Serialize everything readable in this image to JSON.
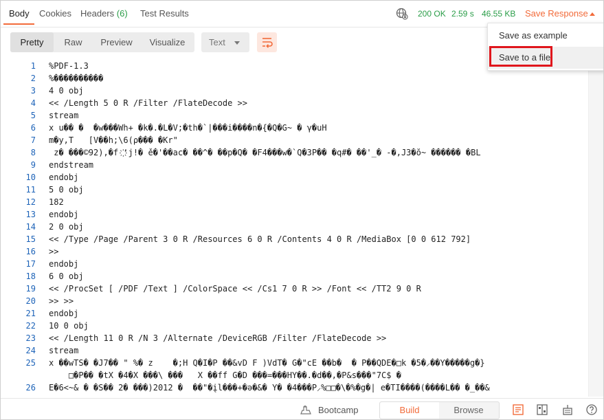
{
  "tabs": {
    "body": "Body",
    "cookies": "Cookies",
    "headers": "Headers",
    "headers_count": "(6)",
    "test_results": "Test Results"
  },
  "status": {
    "code": "200 OK",
    "time": "2.59 s",
    "size": "46.55 KB"
  },
  "save_response": {
    "label": "Save Response",
    "menu": {
      "save_as_example": "Save as example",
      "save_to_file": "Save to a file"
    }
  },
  "toolbar": {
    "pretty": "Pretty",
    "raw": "Raw",
    "preview": "Preview",
    "visualize": "Visualize",
    "format": "Text"
  },
  "code": {
    "lines": [
      {
        "n": "1",
        "t": "%PDF-1.3"
      },
      {
        "n": "2",
        "t": "%����������"
      },
      {
        "n": "3",
        "t": "4 0 obj"
      },
      {
        "n": "4",
        "t": "<< /Length 5 0 R /Filter /FlateDecode >>"
      },
      {
        "n": "5",
        "t": "stream"
      },
      {
        "n": "6",
        "t": "x u�� �  �w���Wh+ �k�.�L�V;�th�`|���i����n�{�Q�G~ � γ�uH"
      },
      {
        "n": "7",
        "t": "m�y,T   [V��h;\\6(ρ��� �Kr\""
      },
      {
        "n": "8",
        "t": " z� ���©92),�f ҉'j!� ě�'��ac� ��^� ��p�Q� �F4���w�`Q�3P�� �q#� ��'_� -�,J3�ŏ~ ������ �BL"
      },
      {
        "n": "9",
        "t": "endstream"
      },
      {
        "n": "10",
        "t": "endobj"
      },
      {
        "n": "11",
        "t": "5 0 obj"
      },
      {
        "n": "12",
        "t": "182"
      },
      {
        "n": "13",
        "t": "endobj"
      },
      {
        "n": "14",
        "t": "2 0 obj"
      },
      {
        "n": "15",
        "t": "<< /Type /Page /Parent 3 0 R /Resources 6 0 R /Contents 4 0 R /MediaBox [0 0 612 792]"
      },
      {
        "n": "16",
        "t": ">>"
      },
      {
        "n": "17",
        "t": "endobj"
      },
      {
        "n": "18",
        "t": "6 0 obj"
      },
      {
        "n": "19",
        "t": "<< /ProcSet [ /PDF /Text ] /ColorSpace << /Cs1 7 0 R >> /Font << /TT2 9 0 R"
      },
      {
        "n": "20",
        "t": ">> >>"
      },
      {
        "n": "21",
        "t": "endobj"
      },
      {
        "n": "22",
        "t": "10 0 obj"
      },
      {
        "n": "23",
        "t": "<< /Length 11 0 R /N 3 /Alternate /DeviceRGB /Filter /FlateDecode >>"
      },
      {
        "n": "24",
        "t": "stream"
      },
      {
        "n": "25",
        "t": "x ��wTS� �J7�� \" %� z    �;H Q�I�P ��&vD F )VdT� G�\"cE ��b�  � P��QDE�□k �5�⸝��Y�����g�}\n    □�P�� �tX �4�X ���\\ ���   X ��ff G�D ���=���HY��.�d��,�P&s���\"7C$ �"
      },
      {
        "n": "26",
        "t": "E�6<~& � �S�� 2� ���)2012 �  ��\"�įl���+�ə�&� Y� �4���P⸝%□□�\\�%�g�| e�TI����(����L�� �_��&"
      }
    ]
  },
  "footer": {
    "bootcamp": "Bootcamp",
    "build": "Build",
    "browse": "Browse"
  },
  "colors": {
    "accent": "#f26b3a",
    "success": "#2a9d48",
    "line_number": "#1d63b8",
    "highlight_box": "#e0161c"
  }
}
